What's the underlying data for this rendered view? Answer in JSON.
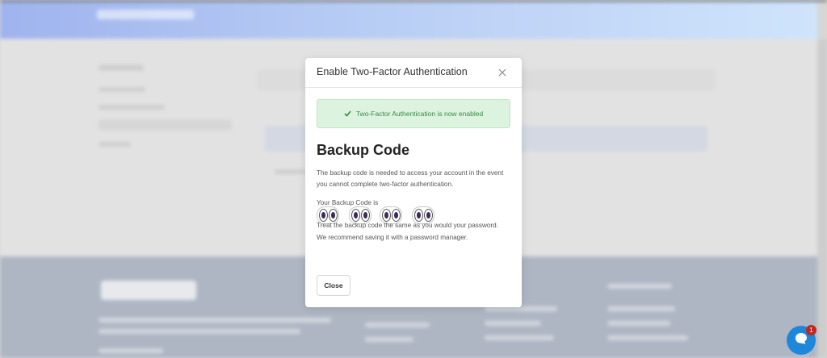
{
  "modal": {
    "title": "Enable Two-Factor Authentication",
    "alert_text": "Two-Factor Authentication is now enabled",
    "heading": "Backup Code",
    "description_line1": "The backup code is needed to access your account in the event",
    "description_line2": "you cannot complete two-factor authentication.",
    "code_label": "Your Backup Code is",
    "treat_line1": "Treat the backup code the same as you would your password.",
    "treat_line2": "We recommend saving it with a password manager.",
    "close_button": "Close"
  },
  "chat_widget": {
    "badge_count": "1"
  },
  "icons": {
    "close": "close-icon",
    "check": "check-icon",
    "redacted": "eyes-icon",
    "chat": "chat-icon"
  },
  "colors": {
    "alert_bg": "#dcf3df",
    "alert_text": "#3a8a46",
    "chat": "#1e87d9",
    "badge": "#c0271f"
  }
}
